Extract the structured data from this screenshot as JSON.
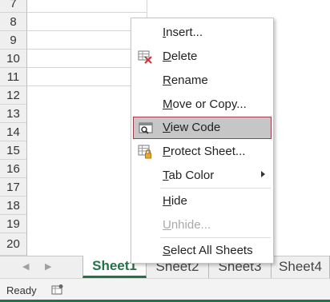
{
  "rows": [
    "7",
    "8",
    "9",
    "10",
    "11",
    "12",
    "13",
    "14",
    "15",
    "16",
    "17",
    "18",
    "19",
    "20"
  ],
  "menu": {
    "items": [
      {
        "id": "insert",
        "pre": "",
        "ul": "I",
        "post": "nsert...",
        "disabled": false,
        "highlight": false,
        "icon": ""
      },
      {
        "id": "delete",
        "pre": "",
        "ul": "D",
        "post": "elete",
        "disabled": false,
        "highlight": false,
        "icon": "delete-sheet-icon"
      },
      {
        "id": "rename",
        "pre": "",
        "ul": "R",
        "post": "ename",
        "disabled": false,
        "highlight": false,
        "icon": ""
      },
      {
        "id": "move-copy",
        "pre": "",
        "ul": "M",
        "post": "ove or Copy...",
        "disabled": false,
        "highlight": false,
        "icon": ""
      },
      {
        "id": "view-code",
        "pre": "",
        "ul": "V",
        "post": "iew Code",
        "disabled": false,
        "highlight": true,
        "icon": "view-code-icon"
      },
      {
        "id": "protect-sheet",
        "pre": "",
        "ul": "P",
        "post": "rotect Sheet...",
        "disabled": false,
        "highlight": false,
        "icon": "protect-sheet-icon"
      },
      {
        "id": "tab-color",
        "pre": "",
        "ul": "T",
        "post": "ab Color",
        "disabled": false,
        "highlight": false,
        "icon": "",
        "submenu": true
      },
      {
        "id": "hide",
        "pre": "",
        "ul": "H",
        "post": "ide",
        "disabled": false,
        "highlight": false,
        "icon": ""
      },
      {
        "id": "unhide",
        "pre": "",
        "ul": "U",
        "post": "nhide...",
        "disabled": true,
        "highlight": false,
        "icon": ""
      },
      {
        "id": "select-all-sheets",
        "pre": "",
        "ul": "S",
        "post": "elect All Sheets",
        "disabled": false,
        "highlight": false,
        "icon": ""
      }
    ]
  },
  "tabs": [
    "Sheet1",
    "Sheet2",
    "Sheet3",
    "Sheet4"
  ],
  "active_tab": "Sheet1",
  "status": {
    "text": "Ready",
    "icon": "macro-record-icon"
  },
  "colors": {
    "accent": "#217346",
    "highlight_border": "#a33a4a",
    "highlight_bg": "#c6c6c6"
  }
}
